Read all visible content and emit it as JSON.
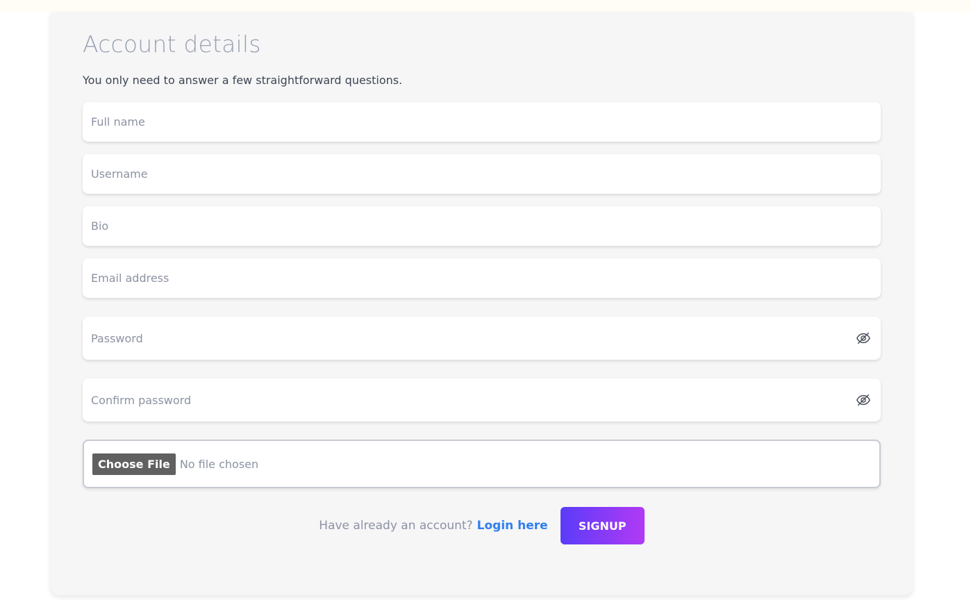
{
  "form": {
    "title": "Account details",
    "subtitle": "You only need to answer a few straightforward questions.",
    "fields": {
      "full_name": {
        "placeholder": "Full name",
        "value": ""
      },
      "username": {
        "placeholder": "Username",
        "value": ""
      },
      "bio": {
        "placeholder": "Bio",
        "value": ""
      },
      "email": {
        "placeholder": "Email address",
        "value": ""
      },
      "password": {
        "placeholder": "Password",
        "value": ""
      },
      "confirm_password": {
        "placeholder": "Confirm password",
        "value": ""
      }
    },
    "file": {
      "button_label": "Choose File",
      "status": "No file chosen"
    },
    "footer": {
      "prompt": "Have already an account?",
      "login_link": "Login here",
      "signup_button": "SIGNUP"
    }
  },
  "icons": {
    "password_toggle": "eye-off-icon",
    "confirm_password_toggle": "eye-off-icon"
  },
  "colors": {
    "title": "#9aa0b3",
    "link": "#2f7ef0",
    "signup_gradient_start": "#5a3cf8",
    "signup_gradient_end": "#b13af5",
    "file_button": "#606060"
  }
}
